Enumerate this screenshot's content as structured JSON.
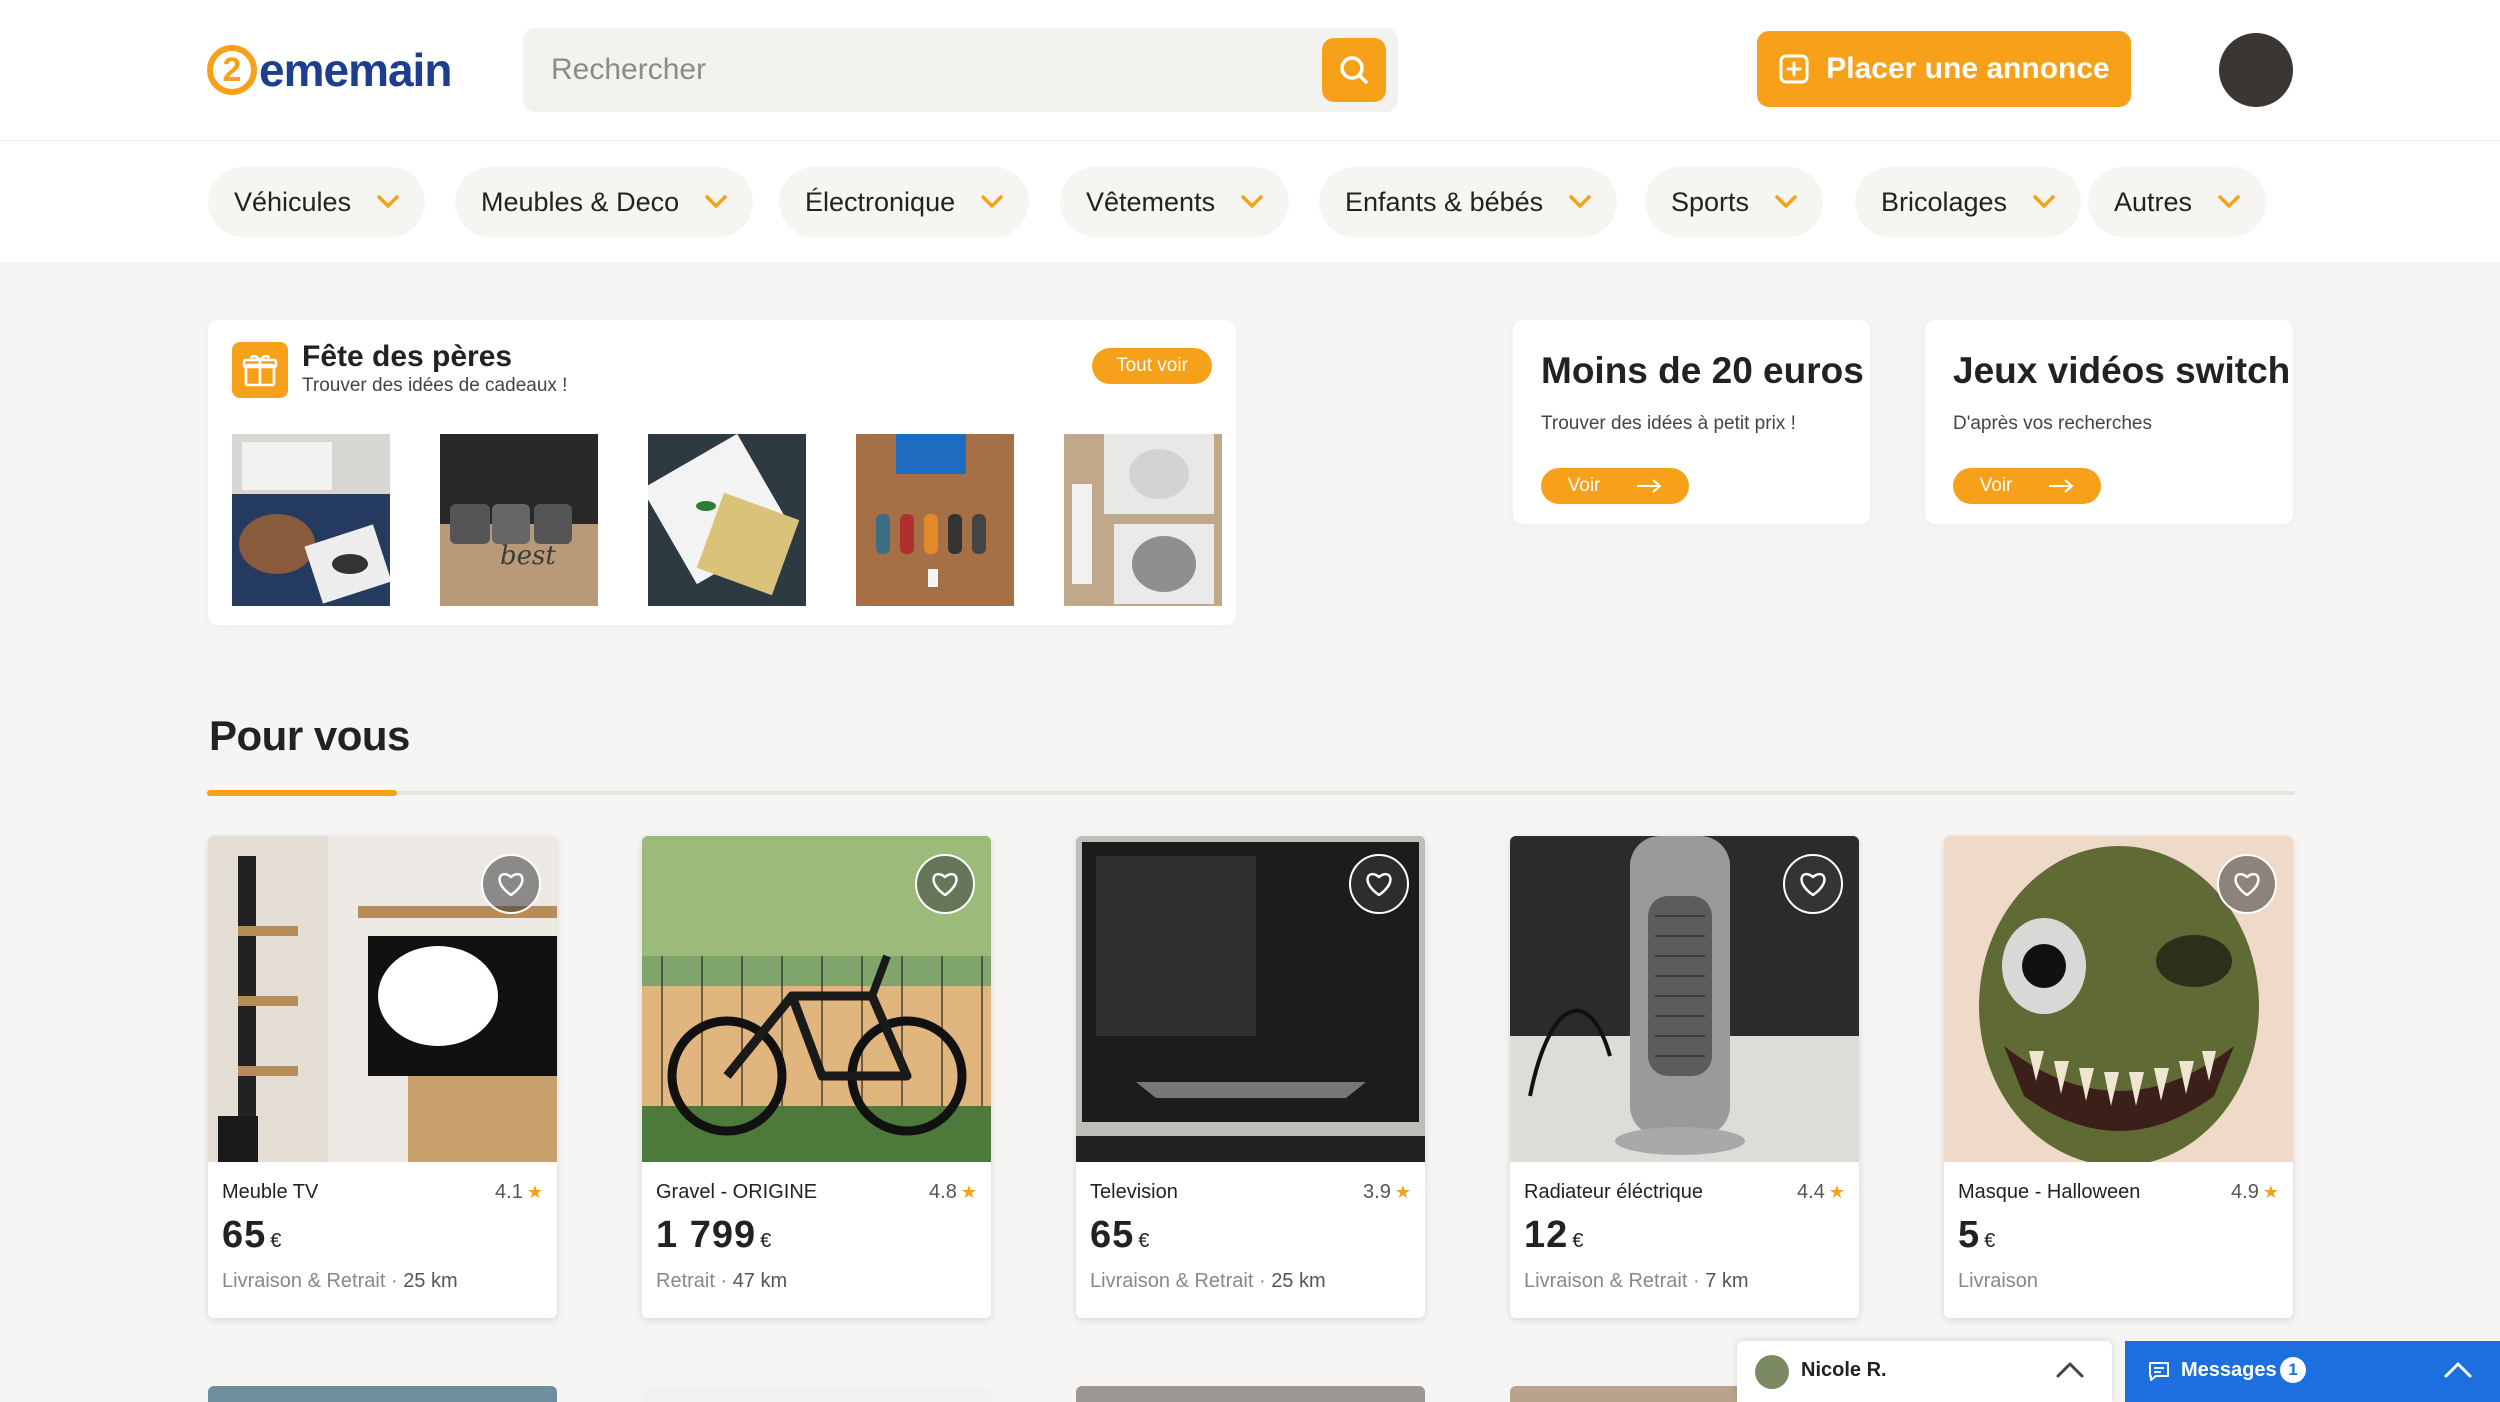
{
  "header": {
    "logo_digit": "2",
    "logo_text": "ememain",
    "search_placeholder": "Rechercher",
    "place_ad_label": "Placer une annonce",
    "accent_color": "#f7a11a"
  },
  "categories": [
    {
      "label": "Véhicules"
    },
    {
      "label": "Meubles & Deco"
    },
    {
      "label": "Électronique"
    },
    {
      "label": "Vêtements"
    },
    {
      "label": "Enfants & bébés"
    },
    {
      "label": "Sports"
    },
    {
      "label": "Bricolages"
    },
    {
      "label": "Autres"
    }
  ],
  "promo": {
    "title": "Fête des pères",
    "subtitle": "Trouver des idées de cadeaux !",
    "see_all": "Tout voir"
  },
  "side_cards": [
    {
      "title": "Moins de 20 euros",
      "subtitle": "Trouver des idées à petit prix !",
      "button": "Voir"
    },
    {
      "title": "Jeux vidéos switch",
      "subtitle": "D'après vos recherches",
      "button": "Voir"
    }
  ],
  "section": {
    "title": "Pour vous"
  },
  "listings": [
    {
      "title": "Meuble TV",
      "rating": "4.1",
      "price": "65",
      "currency": "€",
      "delivery": "Livraison & Retrait",
      "distance": "25 km"
    },
    {
      "title": "Gravel - ORIGINE",
      "rating": "4.8",
      "price": "1 799",
      "currency": "€",
      "delivery": "Retrait",
      "distance": "47 km"
    },
    {
      "title": "Television",
      "rating": "3.9",
      "price": "65",
      "currency": "€",
      "delivery": "Livraison & Retrait",
      "distance": "25 km"
    },
    {
      "title": "Radiateur éléctrique",
      "rating": "4.4",
      "price": "12",
      "currency": "€",
      "delivery": "Livraison & Retrait",
      "distance": "7 km"
    },
    {
      "title": "Masque - Halloween",
      "rating": "4.9",
      "price": "5",
      "currency": "€",
      "delivery": "Livraison",
      "distance": ""
    }
  ],
  "chat": {
    "name": "Nicole R."
  },
  "messages": {
    "label": "Messages",
    "count": "1"
  }
}
